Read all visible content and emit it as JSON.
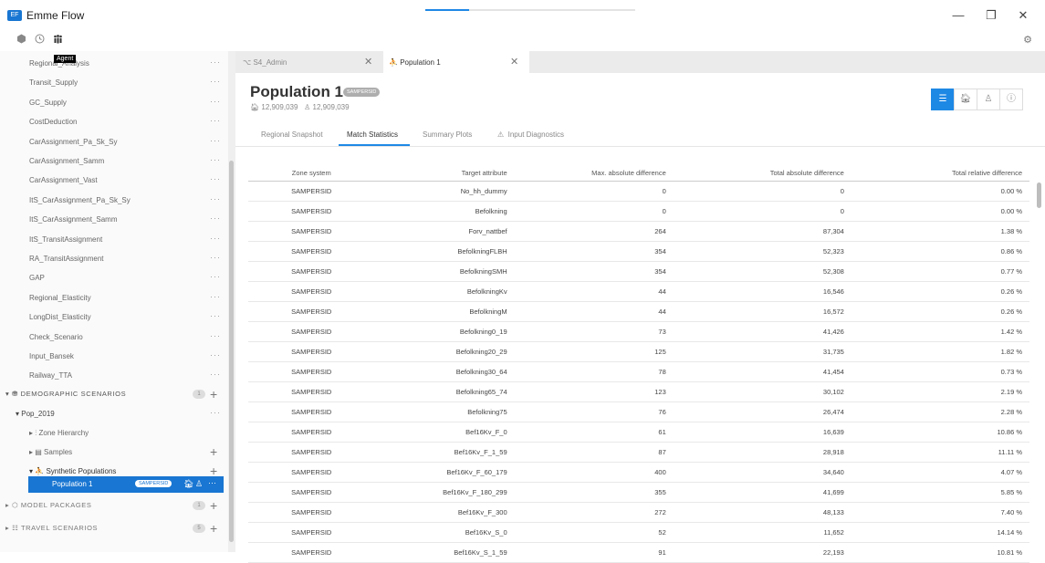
{
  "app": {
    "title": "Emme Flow",
    "logo": "emme-logo"
  },
  "window": {
    "minimize": "—",
    "maximize": "❐",
    "close": "✕"
  },
  "toolbar": {
    "tooltip": "Agent"
  },
  "sidebar": {
    "items": [
      {
        "label": "Regional_Analysis",
        "top": 0
      },
      {
        "label": "Transit_Supply"
      },
      {
        "label": "GC_Supply"
      },
      {
        "label": "CostDeduction"
      },
      {
        "label": "CarAssignment_Pa_Sk_Sy"
      },
      {
        "label": "CarAssignment_Samm"
      },
      {
        "label": "CarAssignment_Vast"
      },
      {
        "label": "ItS_CarAssignment_Pa_Sk_Sy"
      },
      {
        "label": "ItS_CarAssignment_Samm"
      },
      {
        "label": "ItS_TransitAssignment"
      },
      {
        "label": "RA_TransitAssignment"
      },
      {
        "label": "GAP"
      },
      {
        "label": "Regional_Elasticity"
      },
      {
        "label": "LongDist_Elasticity"
      },
      {
        "label": "Check_Scenario"
      },
      {
        "label": "Input_Bansek"
      },
      {
        "label": "Railway_TTA"
      }
    ],
    "dots": "···",
    "demographic": {
      "label": "DEMOGRAPHIC SCENARIOS",
      "count": "1"
    },
    "pop": {
      "label": "Pop_2019"
    },
    "zone_hierarchy": "Zone Hierarchy",
    "samples": "Samples",
    "synthetic": "Synthetic Populations",
    "population_item": {
      "label": "Population 1",
      "badge": "SAMPERSID"
    },
    "model_packages": {
      "label": "MODEL PACKAGES",
      "count": "1"
    },
    "travel_scenarios": {
      "label": "TRAVEL SCENARIOS",
      "count": "5"
    }
  },
  "tabs": [
    {
      "label": "S4_Admin"
    },
    {
      "label": "Population 1"
    }
  ],
  "page": {
    "title": "Population 1",
    "badge": "SAMPERSID",
    "households": "12,909,039",
    "persons": "12,909,039"
  },
  "subtabs": [
    "Regional Snapshot",
    "Match Statistics",
    "Summary Plots",
    "Input Diagnostics"
  ],
  "table": {
    "headers": [
      "Zone system",
      "Target attribute",
      "Max. absolute difference",
      "Total absolute difference",
      "Total relative difference"
    ],
    "rows": [
      [
        "SAMPERSID",
        "No_hh_dummy",
        "0",
        "0",
        "0.00 %"
      ],
      [
        "SAMPERSID",
        "Befolkning",
        "0",
        "0",
        "0.00 %"
      ],
      [
        "SAMPERSID",
        "Forv_nattbef",
        "264",
        "87,304",
        "1.38 %"
      ],
      [
        "SAMPERSID",
        "BefolkningFLBH",
        "354",
        "52,323",
        "0.86 %"
      ],
      [
        "SAMPERSID",
        "BefolkningSMH",
        "354",
        "52,308",
        "0.77 %"
      ],
      [
        "SAMPERSID",
        "BefolkningKv",
        "44",
        "16,546",
        "0.26 %"
      ],
      [
        "SAMPERSID",
        "BefolkningM",
        "44",
        "16,572",
        "0.26 %"
      ],
      [
        "SAMPERSID",
        "Befolkning0_19",
        "73",
        "41,426",
        "1.42 %"
      ],
      [
        "SAMPERSID",
        "Befolkning20_29",
        "125",
        "31,735",
        "1.82 %"
      ],
      [
        "SAMPERSID",
        "Befolkning30_64",
        "78",
        "41,454",
        "0.73 %"
      ],
      [
        "SAMPERSID",
        "Befolkning65_74",
        "123",
        "30,102",
        "2.19 %"
      ],
      [
        "SAMPERSID",
        "Befolkning75",
        "76",
        "26,474",
        "2.28 %"
      ],
      [
        "SAMPERSID",
        "Bef16Kv_F_0",
        "61",
        "16,639",
        "10.86 %"
      ],
      [
        "SAMPERSID",
        "Bef16Kv_F_1_59",
        "87",
        "28,918",
        "11.11 %"
      ],
      [
        "SAMPERSID",
        "Bef16Kv_F_60_179",
        "400",
        "34,640",
        "4.07 %"
      ],
      [
        "SAMPERSID",
        "Bef16Kv_F_180_299",
        "355",
        "41,699",
        "5.85 %"
      ],
      [
        "SAMPERSID",
        "Bef16Kv_F_300",
        "272",
        "48,133",
        "7.40 %"
      ],
      [
        "SAMPERSID",
        "Bef16Kv_S_0",
        "52",
        "11,652",
        "14.14 %"
      ],
      [
        "SAMPERSID",
        "Bef16Kv_S_1_59",
        "91",
        "22,193",
        "10.81 %"
      ]
    ]
  },
  "colors": {
    "accent": "#1e88e5",
    "active_item": "#1976d2"
  }
}
